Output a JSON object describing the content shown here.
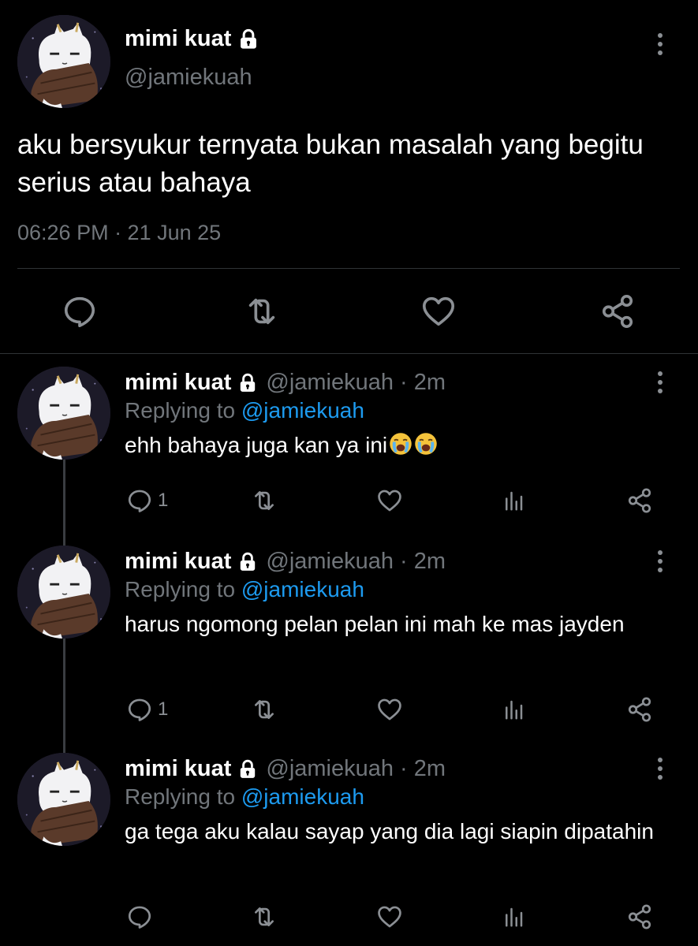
{
  "main_tweet": {
    "name": "mimi kuat",
    "handle": "@jamiekuah",
    "text": "aku bersyukur ternyata bukan masalah yang begitu serius atau bahaya",
    "timestamp": "06:26 PM · 21 Jun 25",
    "icons": {
      "reply": "reply-icon",
      "retweet": "retweet-icon",
      "like": "heart-icon",
      "share": "share-icon"
    }
  },
  "replies": [
    {
      "name": "mimi kuat",
      "handle": "@jamiekuah · 2m",
      "replying_prefix": "Replying to ",
      "replying_to": "@jamiekuah",
      "text": "ehh bahaya juga kan ya ini",
      "emojis": [
        "loudly-crying-face",
        "loudly-crying-face"
      ],
      "reply_count": "1"
    },
    {
      "name": "mimi kuat",
      "handle": "@jamiekuah · 2m",
      "replying_prefix": "Replying to ",
      "replying_to": "@jamiekuah",
      "text": "harus ngomong pelan pelan ini mah ke mas jayden",
      "reply_count": "1"
    },
    {
      "name": "mimi kuat",
      "handle": "@jamiekuah · 2m",
      "replying_prefix": "Replying to ",
      "replying_to": "@jamiekuah",
      "text": "ga tega aku kalau sayap yang dia lagi siapin dipatahin",
      "reply_count": ""
    }
  ],
  "colors": {
    "background": "#000000",
    "text": "#ffffff",
    "muted": "#71767b",
    "link": "#1d9bf0",
    "divider": "#2f3336"
  }
}
